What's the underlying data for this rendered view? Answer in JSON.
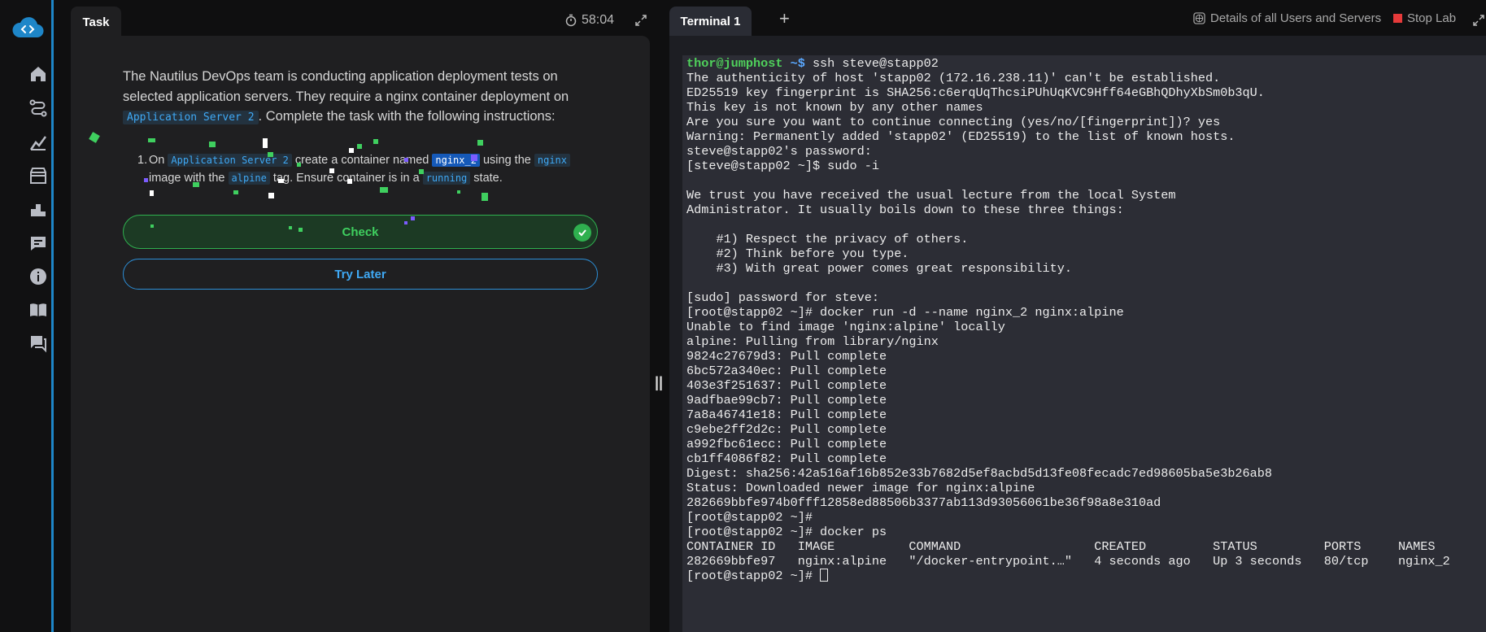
{
  "task_panel": {
    "tab_label": "Task",
    "timer": "58:04",
    "intro_part1": "The Nautilus DevOps team is conducting application deployment tests on selected application servers. They require a nginx container deployment on ",
    "intro_code": "Application Server 2",
    "intro_part2": ". Complete the task with the following instructions:",
    "step_number": "1.",
    "step_t1": "On ",
    "step_c1": "Application Server 2",
    "step_t2": " create a container named ",
    "step_c2": "nginx_2",
    "step_t3": " using the ",
    "step_c3": "nginx",
    "step_t4": " image with the ",
    "step_c4": "alpine",
    "step_t5": " tag. Ensure container is in a ",
    "step_c5": "running",
    "step_t6": " state.",
    "check_label": "Check",
    "try_later_label": "Try Later"
  },
  "terminal": {
    "tab_label": "Terminal 1",
    "add_tab": "+",
    "details_label": "Details of all Users and Servers",
    "stop_label": "Stop Lab",
    "prompt1_user": "thor@jumphost",
    "prompt1_path": " ~$",
    "prompt1_cmd": " ssh steve@stapp02",
    "output": "The authenticity of host 'stapp02 (172.16.238.11)' can't be established.\nED25519 key fingerprint is SHA256:c6erqUqThcsiPUhUqKVC9Hff64eGBhQDhyXbSm0b3qU.\nThis key is not known by any other names\nAre you sure you want to continue connecting (yes/no/[fingerprint])? yes\nWarning: Permanently added 'stapp02' (ED25519) to the list of known hosts.\nsteve@stapp02's password: \n[steve@stapp02 ~]$ sudo -i\n\nWe trust you have received the usual lecture from the local System\nAdministrator. It usually boils down to these three things:\n\n    #1) Respect the privacy of others.\n    #2) Think before you type.\n    #3) With great power comes great responsibility.\n\n[sudo] password for steve: \n[root@stapp02 ~]# docker run -d --name nginx_2 nginx:alpine\nUnable to find image 'nginx:alpine' locally\nalpine: Pulling from library/nginx\n9824c27679d3: Pull complete\n6bc572a340ec: Pull complete\n403e3f251637: Pull complete\n9adfbae99cb7: Pull complete\n7a8a46741e18: Pull complete\nc9ebe2ff2d2c: Pull complete\na992fbc61ecc: Pull complete\ncb1ff4086f82: Pull complete\nDigest: sha256:42a516af16b852e33b7682d5ef8acbd5d13fe08fecadc7ed98605ba5e3b26ab8\nStatus: Downloaded newer image for nginx:alpine\n282669bbfe974b0fff12858ed88506b3377ab113d93056061be36f98a8e310ad\n[root@stapp02 ~]# \n[root@stapp02 ~]# docker ps\nCONTAINER ID   IMAGE          COMMAND                  CREATED         STATUS         PORTS     NAMES\n282669bbfe97   nginx:alpine   \"/docker-entrypoint.…\"   4 seconds ago   Up 3 seconds   80/tcp    nginx_2\n",
    "last_prompt": "[root@stapp02 ~]# "
  },
  "colors": {
    "accent": "#1e86c8",
    "check_green": "#2fb04f",
    "link_blue": "#3fa9f5",
    "stop_red": "#e63a3a"
  },
  "sidebar_icons": [
    "home-icon",
    "route-icon",
    "chart-icon",
    "video-icon",
    "leaderboard-icon",
    "feedback-icon",
    "info-icon",
    "book-icon",
    "chat-icon"
  ]
}
